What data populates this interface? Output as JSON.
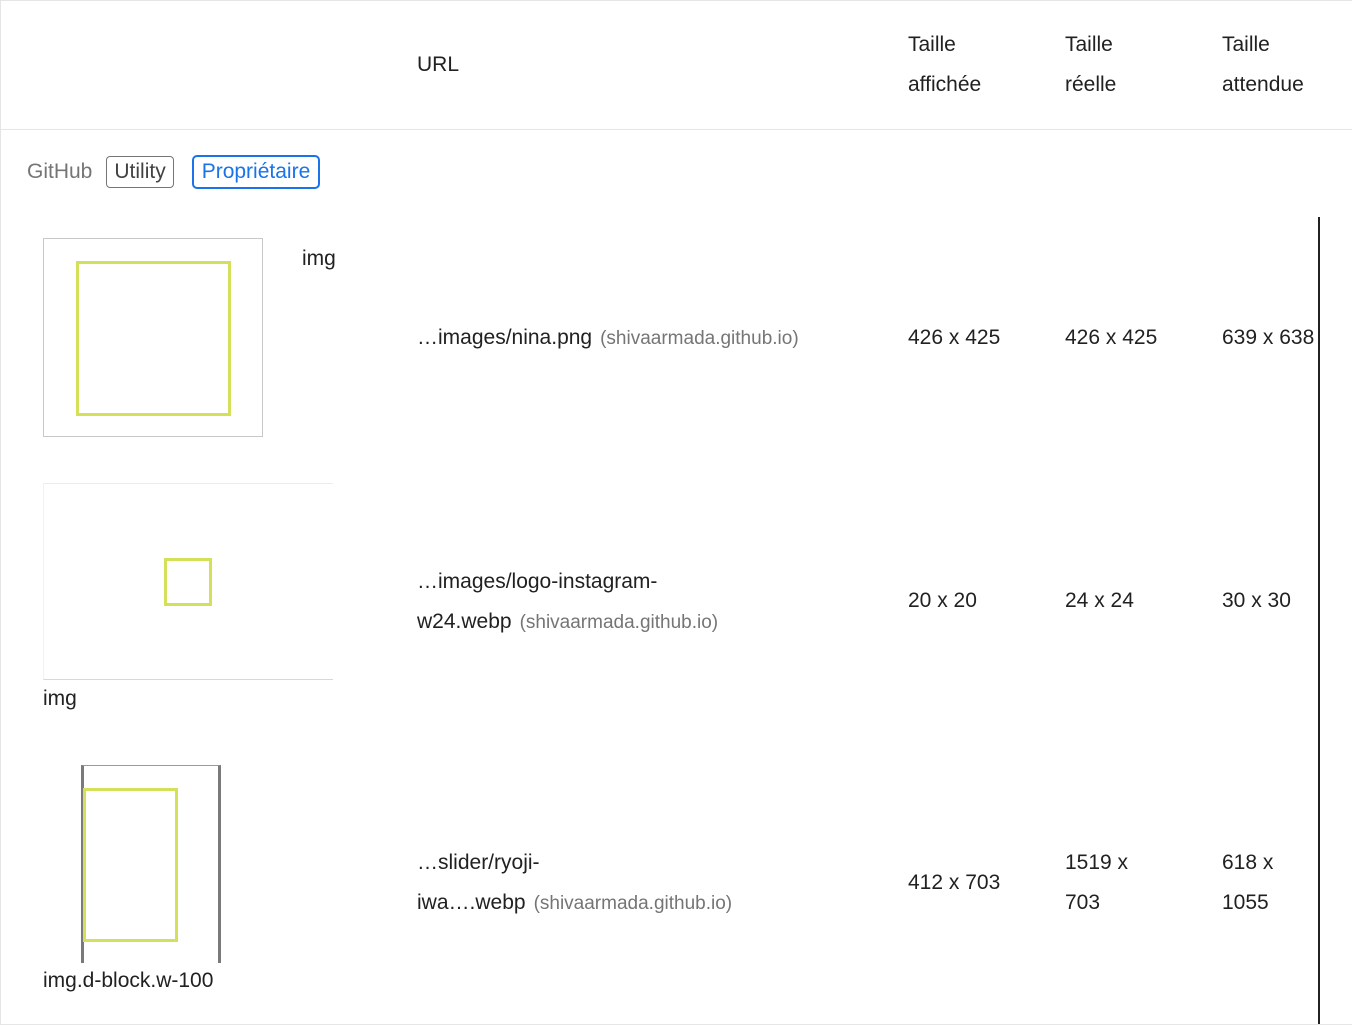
{
  "header": {
    "url": "URL",
    "displayed": [
      "Taille",
      "affichée"
    ],
    "actual": [
      "Taille",
      "réelle"
    ],
    "expected": [
      "Taille",
      "attendue"
    ]
  },
  "group": {
    "name": "GitHub",
    "badge_utility": "Utility",
    "badge_owner": "Propriétaire"
  },
  "rows": [
    {
      "node": "img",
      "url_lines": [
        "…images/nina.png"
      ],
      "origin": "(shivaarmada.github.io)",
      "displayed": [
        "426 x 425"
      ],
      "actual": [
        "426 x 425"
      ],
      "expected": [
        "639 x 638"
      ]
    },
    {
      "node": "img",
      "url_lines": [
        "…images/logo-instagram-",
        "w24.webp"
      ],
      "origin": "(shivaarmada.github.io)",
      "displayed": [
        "20 x 20"
      ],
      "actual": [
        "24 x 24"
      ],
      "expected": [
        "30 x 30"
      ]
    },
    {
      "node": "img.d-block.w-100",
      "url_lines": [
        "…slider/ryoji-",
        "iwa….webp"
      ],
      "origin": "(shivaarmada.github.io)",
      "displayed": [
        "412 x 703"
      ],
      "actual": [
        "1519 x",
        "703"
      ],
      "expected": [
        "618 x",
        "1055"
      ]
    }
  ],
  "colors": {
    "overlay": "#d5e05a",
    "owner_badge": "#1a73e8",
    "muted_text": "#757575"
  }
}
